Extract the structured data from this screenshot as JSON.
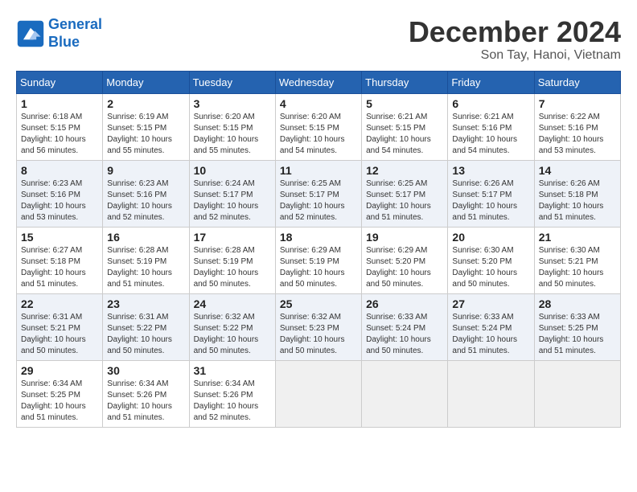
{
  "header": {
    "logo_line1": "General",
    "logo_line2": "Blue",
    "month": "December 2024",
    "location": "Son Tay, Hanoi, Vietnam"
  },
  "weekdays": [
    "Sunday",
    "Monday",
    "Tuesday",
    "Wednesday",
    "Thursday",
    "Friday",
    "Saturday"
  ],
  "weeks": [
    [
      {
        "day": "1",
        "info": "Sunrise: 6:18 AM\nSunset: 5:15 PM\nDaylight: 10 hours\nand 56 minutes."
      },
      {
        "day": "2",
        "info": "Sunrise: 6:19 AM\nSunset: 5:15 PM\nDaylight: 10 hours\nand 55 minutes."
      },
      {
        "day": "3",
        "info": "Sunrise: 6:20 AM\nSunset: 5:15 PM\nDaylight: 10 hours\nand 55 minutes."
      },
      {
        "day": "4",
        "info": "Sunrise: 6:20 AM\nSunset: 5:15 PM\nDaylight: 10 hours\nand 54 minutes."
      },
      {
        "day": "5",
        "info": "Sunrise: 6:21 AM\nSunset: 5:15 PM\nDaylight: 10 hours\nand 54 minutes."
      },
      {
        "day": "6",
        "info": "Sunrise: 6:21 AM\nSunset: 5:16 PM\nDaylight: 10 hours\nand 54 minutes."
      },
      {
        "day": "7",
        "info": "Sunrise: 6:22 AM\nSunset: 5:16 PM\nDaylight: 10 hours\nand 53 minutes."
      }
    ],
    [
      {
        "day": "8",
        "info": "Sunrise: 6:23 AM\nSunset: 5:16 PM\nDaylight: 10 hours\nand 53 minutes."
      },
      {
        "day": "9",
        "info": "Sunrise: 6:23 AM\nSunset: 5:16 PM\nDaylight: 10 hours\nand 52 minutes."
      },
      {
        "day": "10",
        "info": "Sunrise: 6:24 AM\nSunset: 5:17 PM\nDaylight: 10 hours\nand 52 minutes."
      },
      {
        "day": "11",
        "info": "Sunrise: 6:25 AM\nSunset: 5:17 PM\nDaylight: 10 hours\nand 52 minutes."
      },
      {
        "day": "12",
        "info": "Sunrise: 6:25 AM\nSunset: 5:17 PM\nDaylight: 10 hours\nand 51 minutes."
      },
      {
        "day": "13",
        "info": "Sunrise: 6:26 AM\nSunset: 5:17 PM\nDaylight: 10 hours\nand 51 minutes."
      },
      {
        "day": "14",
        "info": "Sunrise: 6:26 AM\nSunset: 5:18 PM\nDaylight: 10 hours\nand 51 minutes."
      }
    ],
    [
      {
        "day": "15",
        "info": "Sunrise: 6:27 AM\nSunset: 5:18 PM\nDaylight: 10 hours\nand 51 minutes."
      },
      {
        "day": "16",
        "info": "Sunrise: 6:28 AM\nSunset: 5:19 PM\nDaylight: 10 hours\nand 51 minutes."
      },
      {
        "day": "17",
        "info": "Sunrise: 6:28 AM\nSunset: 5:19 PM\nDaylight: 10 hours\nand 50 minutes."
      },
      {
        "day": "18",
        "info": "Sunrise: 6:29 AM\nSunset: 5:19 PM\nDaylight: 10 hours\nand 50 minutes."
      },
      {
        "day": "19",
        "info": "Sunrise: 6:29 AM\nSunset: 5:20 PM\nDaylight: 10 hours\nand 50 minutes."
      },
      {
        "day": "20",
        "info": "Sunrise: 6:30 AM\nSunset: 5:20 PM\nDaylight: 10 hours\nand 50 minutes."
      },
      {
        "day": "21",
        "info": "Sunrise: 6:30 AM\nSunset: 5:21 PM\nDaylight: 10 hours\nand 50 minutes."
      }
    ],
    [
      {
        "day": "22",
        "info": "Sunrise: 6:31 AM\nSunset: 5:21 PM\nDaylight: 10 hours\nand 50 minutes."
      },
      {
        "day": "23",
        "info": "Sunrise: 6:31 AM\nSunset: 5:22 PM\nDaylight: 10 hours\nand 50 minutes."
      },
      {
        "day": "24",
        "info": "Sunrise: 6:32 AM\nSunset: 5:22 PM\nDaylight: 10 hours\nand 50 minutes."
      },
      {
        "day": "25",
        "info": "Sunrise: 6:32 AM\nSunset: 5:23 PM\nDaylight: 10 hours\nand 50 minutes."
      },
      {
        "day": "26",
        "info": "Sunrise: 6:33 AM\nSunset: 5:24 PM\nDaylight: 10 hours\nand 50 minutes."
      },
      {
        "day": "27",
        "info": "Sunrise: 6:33 AM\nSunset: 5:24 PM\nDaylight: 10 hours\nand 51 minutes."
      },
      {
        "day": "28",
        "info": "Sunrise: 6:33 AM\nSunset: 5:25 PM\nDaylight: 10 hours\nand 51 minutes."
      }
    ],
    [
      {
        "day": "29",
        "info": "Sunrise: 6:34 AM\nSunset: 5:25 PM\nDaylight: 10 hours\nand 51 minutes."
      },
      {
        "day": "30",
        "info": "Sunrise: 6:34 AM\nSunset: 5:26 PM\nDaylight: 10 hours\nand 51 minutes."
      },
      {
        "day": "31",
        "info": "Sunrise: 6:34 AM\nSunset: 5:26 PM\nDaylight: 10 hours\nand 52 minutes."
      },
      {
        "day": "",
        "info": ""
      },
      {
        "day": "",
        "info": ""
      },
      {
        "day": "",
        "info": ""
      },
      {
        "day": "",
        "info": ""
      }
    ]
  ]
}
